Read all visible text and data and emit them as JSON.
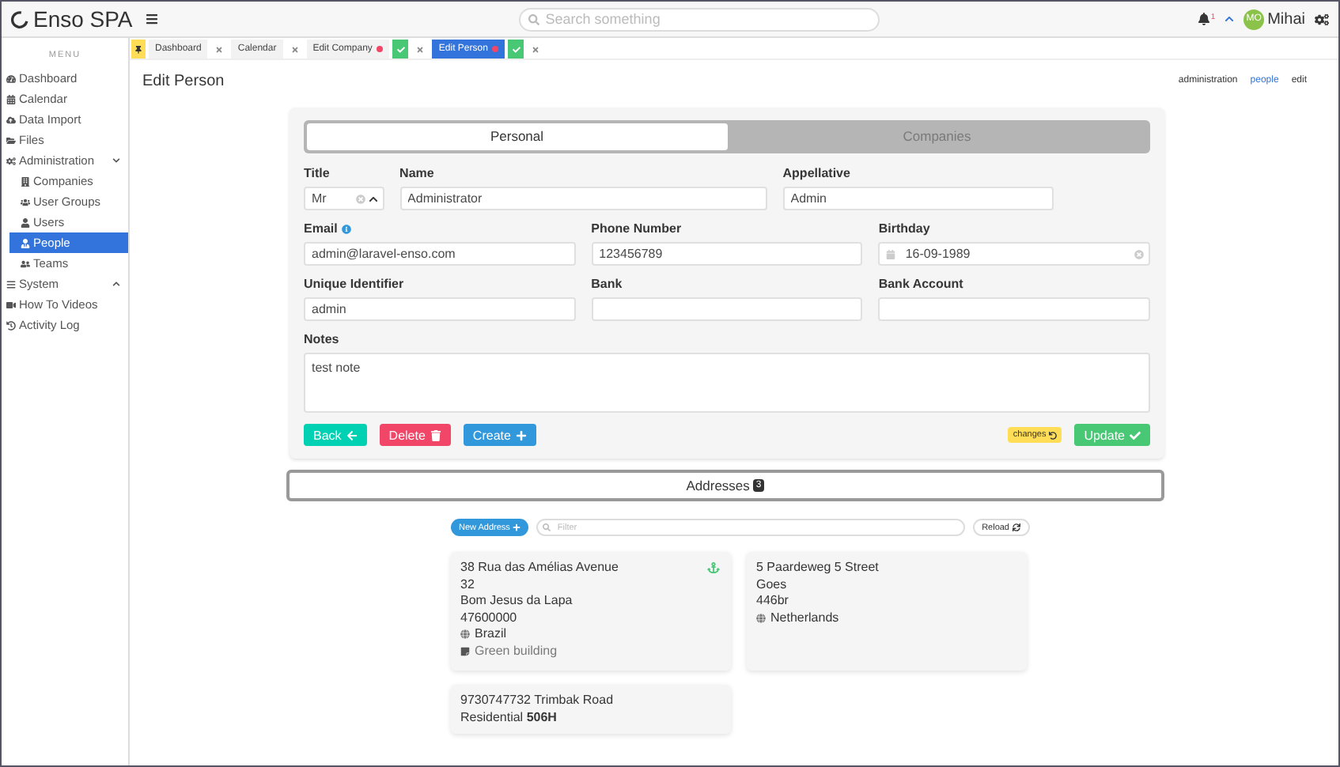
{
  "app": {
    "title": "Enso SPA"
  },
  "search": {
    "placeholder": "Search something"
  },
  "user": {
    "initials": "MO",
    "name": "Mihai",
    "notifications": "1"
  },
  "sidebar": {
    "heading": "MENU",
    "items": [
      {
        "label": "Dashboard",
        "selected": false
      },
      {
        "label": "Calendar",
        "selected": false
      },
      {
        "label": "Data Import",
        "selected": false
      },
      {
        "label": "Files",
        "selected": false
      },
      {
        "label": "Administration",
        "selected": false,
        "expanded": true,
        "children": [
          {
            "label": "Companies",
            "selected": false
          },
          {
            "label": "User Groups",
            "selected": false
          },
          {
            "label": "Users",
            "selected": false
          },
          {
            "label": "People",
            "selected": true
          },
          {
            "label": "Teams",
            "selected": false
          }
        ]
      },
      {
        "label": "System",
        "selected": false,
        "expanded": false
      },
      {
        "label": "How To Videos",
        "selected": false
      },
      {
        "label": "Activity Log",
        "selected": false
      }
    ]
  },
  "tabs": [
    {
      "label": "Dashboard",
      "selected": false,
      "dirty": false
    },
    {
      "label": "Calendar",
      "selected": false,
      "dirty": false
    },
    {
      "label": "Edit Company",
      "selected": false,
      "dirty": true
    },
    {
      "label": "Edit Person",
      "selected": true,
      "dirty": true
    }
  ],
  "page": {
    "title": "Edit Person",
    "breadcrumbs": [
      {
        "label": "administration",
        "link": false
      },
      {
        "label": "people",
        "link": true
      },
      {
        "label": "edit",
        "link": false
      }
    ]
  },
  "form_tabs": [
    {
      "label": "Personal",
      "selected": true
    },
    {
      "label": "Companies",
      "selected": false
    }
  ],
  "fields": [
    {
      "kind": "select",
      "label": "Title",
      "value": "Mr"
    },
    {
      "kind": "text",
      "label": "Name",
      "value": "Administrator"
    },
    {
      "kind": "text",
      "label": "Appellative",
      "value": "Admin"
    },
    {
      "kind": "text",
      "label": "Email",
      "value": "admin@laravel-enso.com",
      "info": true
    },
    {
      "kind": "text",
      "label": "Phone Number",
      "value": "123456789"
    },
    {
      "kind": "date",
      "label": "Birthday",
      "value": "16-09-1989"
    },
    {
      "kind": "text",
      "label": "Unique Identifier",
      "value": "admin"
    },
    {
      "kind": "text",
      "label": "Bank"
    },
    {
      "kind": "text",
      "label": "Bank Account"
    },
    {
      "kind": "textarea",
      "label": "Notes",
      "value": "test note"
    }
  ],
  "actions": [
    {
      "kind": "back",
      "label": "Back"
    },
    {
      "kind": "delete",
      "label": "Delete"
    },
    {
      "kind": "create",
      "label": "Create"
    }
  ],
  "changes": {
    "label": "changes"
  },
  "submit": {
    "label": "Update"
  },
  "addresses": {
    "title": "Addresses",
    "count": "3",
    "new_label": "New Address",
    "filter_placeholder": "Filter",
    "reload_label": "Reload",
    "cards": [
      {
        "lines": [
          "38 Rua das Amélias Avenue",
          "32",
          "Bom Jesus da Lapa",
          "47600000"
        ],
        "country": "Brazil",
        "note": "Green building",
        "default": true
      },
      {
        "lines": [
          "5 Paardeweg 5 Street",
          "Goes",
          "446br"
        ],
        "country": "Netherlands",
        "default": false
      },
      {
        "lines": [
          "9730747732 Trimbak Road"
        ],
        "type": "Residential",
        "extra": "506H",
        "default": false
      }
    ]
  }
}
